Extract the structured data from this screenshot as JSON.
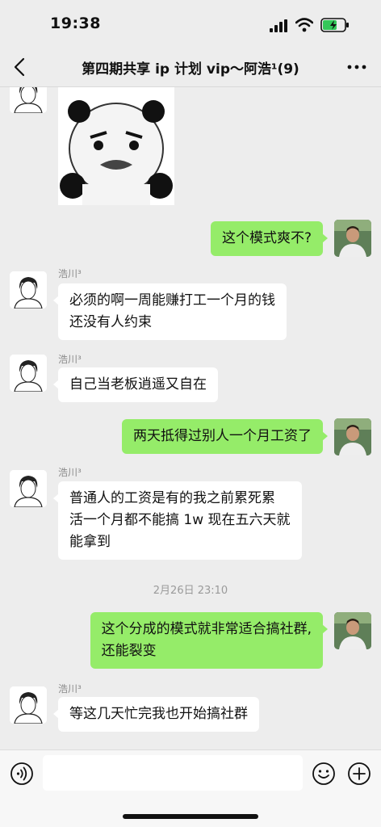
{
  "status": {
    "time": "19:38"
  },
  "header": {
    "title": "第四期共享 ip 计划 vip～阿浩¹(9)"
  },
  "messages": [
    {
      "kind": "sticker",
      "side": "left",
      "icon": "panda-meme-sticker"
    },
    {
      "kind": "text",
      "side": "right",
      "lines": [
        "这个模式爽不?"
      ]
    },
    {
      "kind": "text",
      "side": "left",
      "sender": "浩川³",
      "lines": [
        "必须的啊一周能赚打工一个月的钱",
        "还没有人约束"
      ]
    },
    {
      "kind": "text",
      "side": "left",
      "sender": "浩川³",
      "lines": [
        "自己当老板逍遥又自在"
      ]
    },
    {
      "kind": "text",
      "side": "right",
      "lines": [
        "两天抵得过别人一个月工资了"
      ]
    },
    {
      "kind": "text",
      "side": "left",
      "sender": "浩川³",
      "lines": [
        "普通人的工资是有的我之前累死累",
        "活一个月都不能搞 1w 现在五六天就",
        "能拿到"
      ]
    },
    {
      "kind": "time",
      "text": "2月26日 23:10"
    },
    {
      "kind": "text",
      "side": "right",
      "lines": [
        "这个分成的模式就非常适合搞社群,",
        "还能裂变"
      ]
    },
    {
      "kind": "text",
      "side": "left",
      "sender": "浩川³",
      "lines": [
        "等这几天忙完我也开始搞社群"
      ]
    }
  ],
  "input": {
    "placeholder": ""
  },
  "colors": {
    "background": "#ededed",
    "bubble_right": "#95ec69",
    "bubble_left": "#ffffff"
  },
  "icons": {
    "back": "chevron-left-icon",
    "more": "more-dots-icon",
    "voice": "voice-icon",
    "emoji": "emoji-icon",
    "plus": "plus-icon"
  }
}
